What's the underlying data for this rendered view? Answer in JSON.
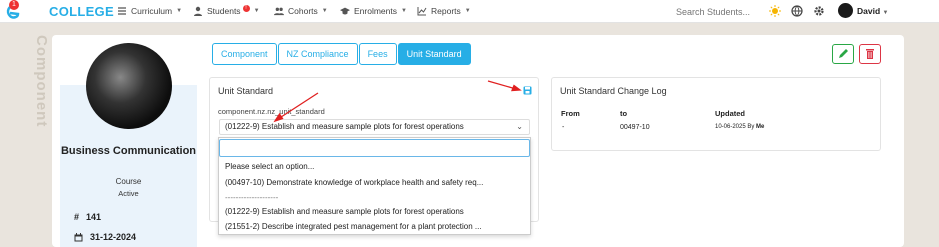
{
  "app": {
    "brand": "COLLEGE",
    "logo_badge": "1"
  },
  "nav": {
    "items": [
      {
        "label": "Curriculum",
        "icon": "menu-icon"
      },
      {
        "label": "Students",
        "icon": "person-icon",
        "badge": "!"
      },
      {
        "label": "Cohorts",
        "icon": "people-icon"
      },
      {
        "label": "Enrolments",
        "icon": "graduation-icon"
      },
      {
        "label": "Reports",
        "icon": "chart-icon"
      }
    ],
    "search_placeholder": "Search Students...",
    "user_name": "David"
  },
  "side_label": "Component",
  "profile": {
    "name": "Business Communication",
    "type": "Course",
    "status": "Active",
    "id": "141",
    "date": "31-12-2024"
  },
  "tabs": [
    {
      "label": "Component",
      "active": false
    },
    {
      "label": "NZ Compliance",
      "active": false
    },
    {
      "label": "Fees",
      "active": false
    },
    {
      "label": "Unit Standard",
      "active": true
    }
  ],
  "unit_standard": {
    "title": "Unit Standard",
    "field_label": "component.nz.nz_unit_standard",
    "selected": "(01222-9) Establish and measure sample plots for forest operations",
    "options": [
      "Please select an option...",
      "(00497-10) Demonstrate knowledge of workplace health and safety req...",
      "--------------------",
      "(01222-9) Establish and measure sample plots for forest operations",
      "(21551-2) Describe integrated pest management for a plant protection ..."
    ]
  },
  "change_log": {
    "title": "Unit Standard Change Log",
    "headers": [
      "From",
      "to",
      "Updated"
    ],
    "rows": [
      {
        "from": "-",
        "to": "00497-10",
        "updated": "10-06-2025 By",
        "by": "Me"
      }
    ]
  },
  "colors": {
    "accent": "#27aee6",
    "danger": "#dc3545",
    "success": "#29a745",
    "annotation": "#e02020"
  }
}
